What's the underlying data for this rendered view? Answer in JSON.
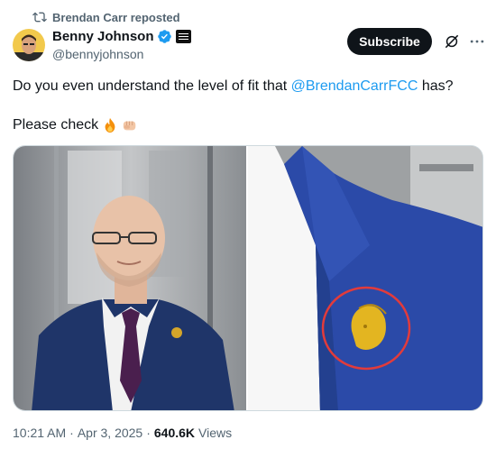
{
  "repost": {
    "text": "Brendan Carr reposted",
    "icon": "repost-icon"
  },
  "author": {
    "name": "Benny Johnson",
    "handle": "@bennyjohnson",
    "verified_color": "#1d9bf0"
  },
  "actions": {
    "subscribe_label": "Subscribe",
    "grok_icon": "grok-icon",
    "more_icon": "more-icon"
  },
  "tweet": {
    "line1_prefix": "Do you even understand the level of fit that ",
    "mention": "@BrendanCarrFCC",
    "line1_suffix": " has?",
    "line2": "Please check",
    "emojis": [
      "fire-emoji",
      "fist-emoji"
    ]
  },
  "media": {
    "count": 2
  },
  "meta": {
    "time": "10:21 AM",
    "date": "Apr 3, 2025",
    "views_count": "640.6K",
    "views_label": "Views"
  },
  "colors": {
    "accent": "#1d9bf0",
    "text": "#0f1419",
    "muted": "#536471"
  }
}
